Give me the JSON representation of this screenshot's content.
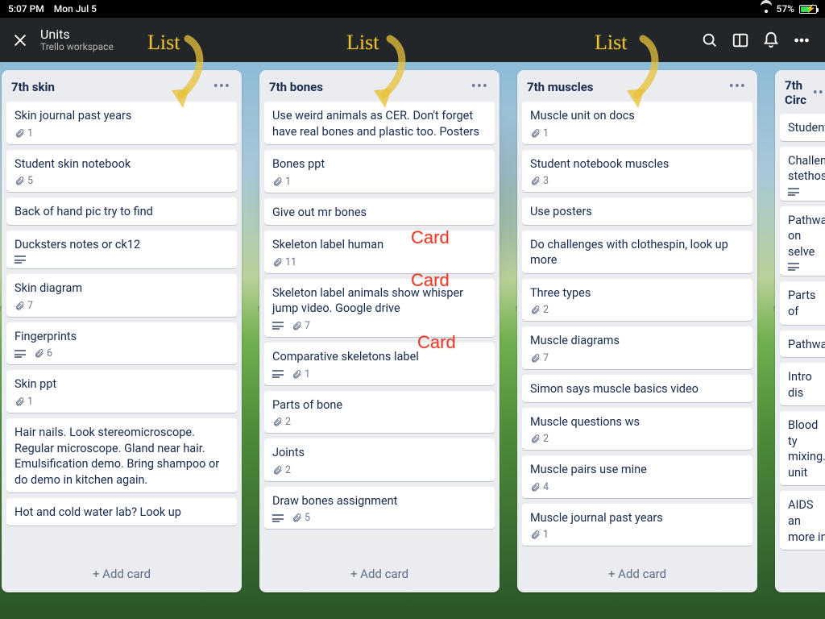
{
  "status": {
    "time": "5:07 PM",
    "date": "Mon Jul 5",
    "battery": "57%"
  },
  "header": {
    "title": "Units",
    "subtitle": "Trello workspace"
  },
  "addCardLabel": "+ Add card",
  "annotations": {
    "list1": "List",
    "list2": "List",
    "list3": "List",
    "card1": "Card",
    "card2": "Card",
    "card3": "Card"
  },
  "lists": [
    {
      "title": "7th skin",
      "cards": [
        {
          "title": "Skin journal past years",
          "attach": 1
        },
        {
          "title": "Student skin notebook",
          "attach": 5
        },
        {
          "title": "Back of hand pic try to find"
        },
        {
          "title": "Ducksters notes or ck12",
          "desc": true
        },
        {
          "title": "Skin diagram",
          "attach": 7
        },
        {
          "title": "Fingerprints",
          "desc": true,
          "attach": 6
        },
        {
          "title": "Skin ppt",
          "attach": 1
        },
        {
          "title": "Hair nails. Look stereomicroscope. Regular microscope. Gland near hair. Emulsification demo.  Bring shampoo or do demo in kitchen again."
        },
        {
          "title": "Hot and cold water lab? Look up"
        }
      ]
    },
    {
      "title": "7th bones",
      "cards": [
        {
          "title": "Use weird animals as CER.  Don't forget have real bones and plastic too. Posters"
        },
        {
          "title": "Bones ppt",
          "attach": 1
        },
        {
          "title": "Give out mr bones"
        },
        {
          "title": "Skeleton label human",
          "attach": 11
        },
        {
          "title": "Skeleton label animals show whisper jump video. Google drive",
          "desc": true,
          "attach": 7
        },
        {
          "title": "Comparative skeletons label",
          "desc": true,
          "attach": 1
        },
        {
          "title": "Parts of bone",
          "attach": 2
        },
        {
          "title": "Joints",
          "attach": 2
        },
        {
          "title": "Draw bones assignment",
          "desc": true,
          "attach": 5
        }
      ]
    },
    {
      "title": "7th muscles",
      "cards": [
        {
          "title": "Muscle unit on docs",
          "attach": 1
        },
        {
          "title": "Student notebook muscles",
          "attach": 3
        },
        {
          "title": "Use posters"
        },
        {
          "title": "Do challenges with clothespin, look up more"
        },
        {
          "title": "Three types",
          "attach": 2
        },
        {
          "title": "Muscle diagrams",
          "attach": 7
        },
        {
          "title": "Simon says muscle basics video"
        },
        {
          "title": "Muscle questions ws",
          "attach": 2
        },
        {
          "title": "Muscle pairs use mine",
          "attach": 4
        },
        {
          "title": "Muscle journal past years",
          "attach": 1
        }
      ]
    },
    {
      "title": "7th Circ",
      "cards": [
        {
          "title": "Student"
        },
        {
          "title": "Challen stethos",
          "desc": true
        },
        {
          "title": "Pathwa on selve",
          "desc": true
        },
        {
          "title": "Parts of"
        },
        {
          "title": "Pathwa"
        },
        {
          "title": "Intro dis"
        },
        {
          "title": "Blood ty mixing. unit"
        },
        {
          "title": "AIDS an more in"
        }
      ]
    }
  ]
}
